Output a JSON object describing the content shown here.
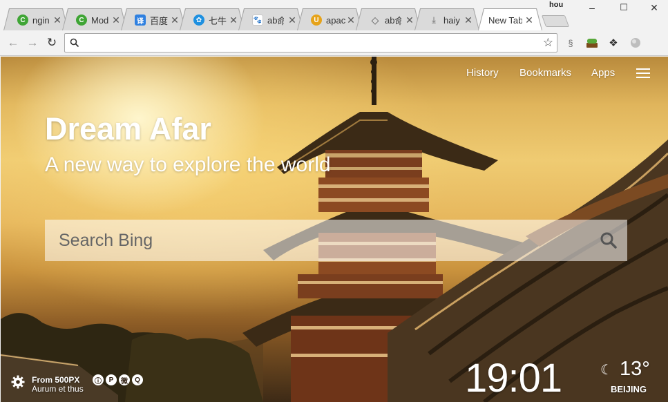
{
  "browser": {
    "profile_name": "hou",
    "tabs": [
      {
        "title": "ngin",
        "favicon": "green-c-icon",
        "color": "#3fa535"
      },
      {
        "title": "Mod",
        "favicon": "green-c-icon",
        "color": "#3fa535"
      },
      {
        "title": "百度",
        "favicon": "translate-icon",
        "color": "#2f80e0",
        "glyph": "译"
      },
      {
        "title": "七牛",
        "favicon": "qiniu-icon",
        "color": "#1e90e0"
      },
      {
        "title": "ab",
        "favicon": "baidu-paw-icon",
        "color": "#2932e1",
        "suffix": "命"
      },
      {
        "title": "apac",
        "favicon": "u-icon",
        "color": "#e6a31a",
        "glyph": "U"
      },
      {
        "title": "ab",
        "favicon": "diamond-icon",
        "color": "#555555",
        "suffix": "命"
      },
      {
        "title": "haiy",
        "favicon": "download-icon",
        "color": "#888888"
      },
      {
        "title": "New Tab",
        "favicon": "",
        "color": "#ffffff",
        "active": true
      }
    ],
    "window_controls": {
      "minimize": "–",
      "maximize": "☐",
      "close": "✕"
    },
    "toolbar": {
      "back": "←",
      "forward": "→",
      "reload": "↻",
      "omnibox_value": "",
      "bookmark_star": "☆"
    }
  },
  "page": {
    "nav": {
      "history": "History",
      "bookmarks": "Bookmarks",
      "apps": "Apps"
    },
    "brand_title": "Dream Afar",
    "tagline": "A new way to explore the world",
    "search_placeholder": "Search Bing",
    "photo_credit": {
      "source": "From 500PX",
      "author": "Aurum et thus"
    },
    "clock": "19:01",
    "weather": {
      "temperature": "13°",
      "city": "BEIJING",
      "condition_icon": "moon-icon"
    }
  }
}
